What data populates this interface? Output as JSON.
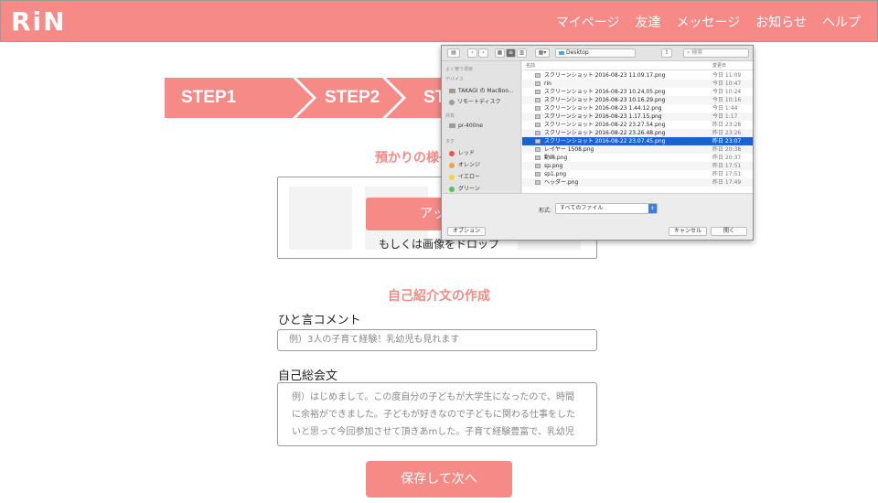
{
  "header": {
    "logo": "RiN",
    "nav": [
      "マイページ",
      "友達",
      "メッセージ",
      "お知らせ",
      "ヘルプ"
    ]
  },
  "steps": {
    "items": [
      "STEP1",
      "STEP2",
      "ST"
    ]
  },
  "upload": {
    "title": "預かりの様子がわかる",
    "button_label": "アップ",
    "drop_text": "もしくは画像をドロップ"
  },
  "intro": {
    "title": "自己紹介文の作成",
    "comment_label": "ひと言コメント",
    "comment_placeholder": "例）3人の子育て経験！乳幼児も見れます",
    "bio_label": "自己総会文",
    "bio_placeholder_lines": [
      "例）はじめまして。この度自分の子どもが大学生になったので、時間",
      "に余裕ができました。子どもが好きなので子どもに関わる仕事をした",
      "いと思って今回参加させて頂きあmした。子育て経験豊富で、乳幼児"
    ],
    "save_label": "保存して次へ"
  },
  "file_dialog": {
    "location": "Desktop",
    "search_placeholder": "検索",
    "sidebar": {
      "favorites_head": "よく使う項目",
      "devices_head": "デバイス",
      "devices": [
        "TAKAGI の MacBoo...",
        "リモートディスク"
      ],
      "shared_head": "共有",
      "shared": [
        "pr-400ne"
      ],
      "tags_head": "タグ",
      "tags": [
        {
          "label": "レッド",
          "color": "#f0504a"
        },
        {
          "label": "オレンジ",
          "color": "#f5a431"
        },
        {
          "label": "イエロー",
          "color": "#f3d43a"
        },
        {
          "label": "グリーン",
          "color": "#5ac44b"
        }
      ]
    },
    "columns": {
      "name": "名前",
      "date": "変更日"
    },
    "files": [
      {
        "name": "スクリーンショット 2016-08-23 11.09.17.png",
        "date": "今日 11:09"
      },
      {
        "name": "rin",
        "date": "今日 10:47"
      },
      {
        "name": "スクリーンショット 2016-08-23 10.24.05.png",
        "date": "今日 10:24"
      },
      {
        "name": "スクリーンショット 2016-08-23 10.16.29.png",
        "date": "今日 10:16"
      },
      {
        "name": "スクリーンショット 2016-08-23 1.44.12.png",
        "date": "今日 1:44"
      },
      {
        "name": "スクリーンショット 2016-08-23 1.17.15.png",
        "date": "今日 1:17"
      },
      {
        "name": "スクリーンショット 2016-08-22 23.27.54.png",
        "date": "昨日 23:28"
      },
      {
        "name": "スクリーンショット 2016-08-22 23.26.48.png",
        "date": "昨日 23:26"
      },
      {
        "name": "スクリーンショット 2016-08-22 23.07.45.png",
        "date": "昨日 23:07"
      },
      {
        "name": "レイヤー 1508.png",
        "date": "昨日 20:38"
      },
      {
        "name": "動画.png",
        "date": "昨日 20:37"
      },
      {
        "name": "sp.png",
        "date": "昨日 17:51"
      },
      {
        "name": "sp1.png",
        "date": "昨日 17:51"
      },
      {
        "name": "ヘッダー.png",
        "date": "昨日 17:49"
      }
    ],
    "selected_index": 8,
    "format_label": "形式:",
    "format_value": "すべてのファイル",
    "options_label": "オプション",
    "cancel_label": "キャンセル",
    "open_label": "開く"
  },
  "colors": {
    "accent": "#f58a87",
    "selection": "#1c63d1"
  }
}
